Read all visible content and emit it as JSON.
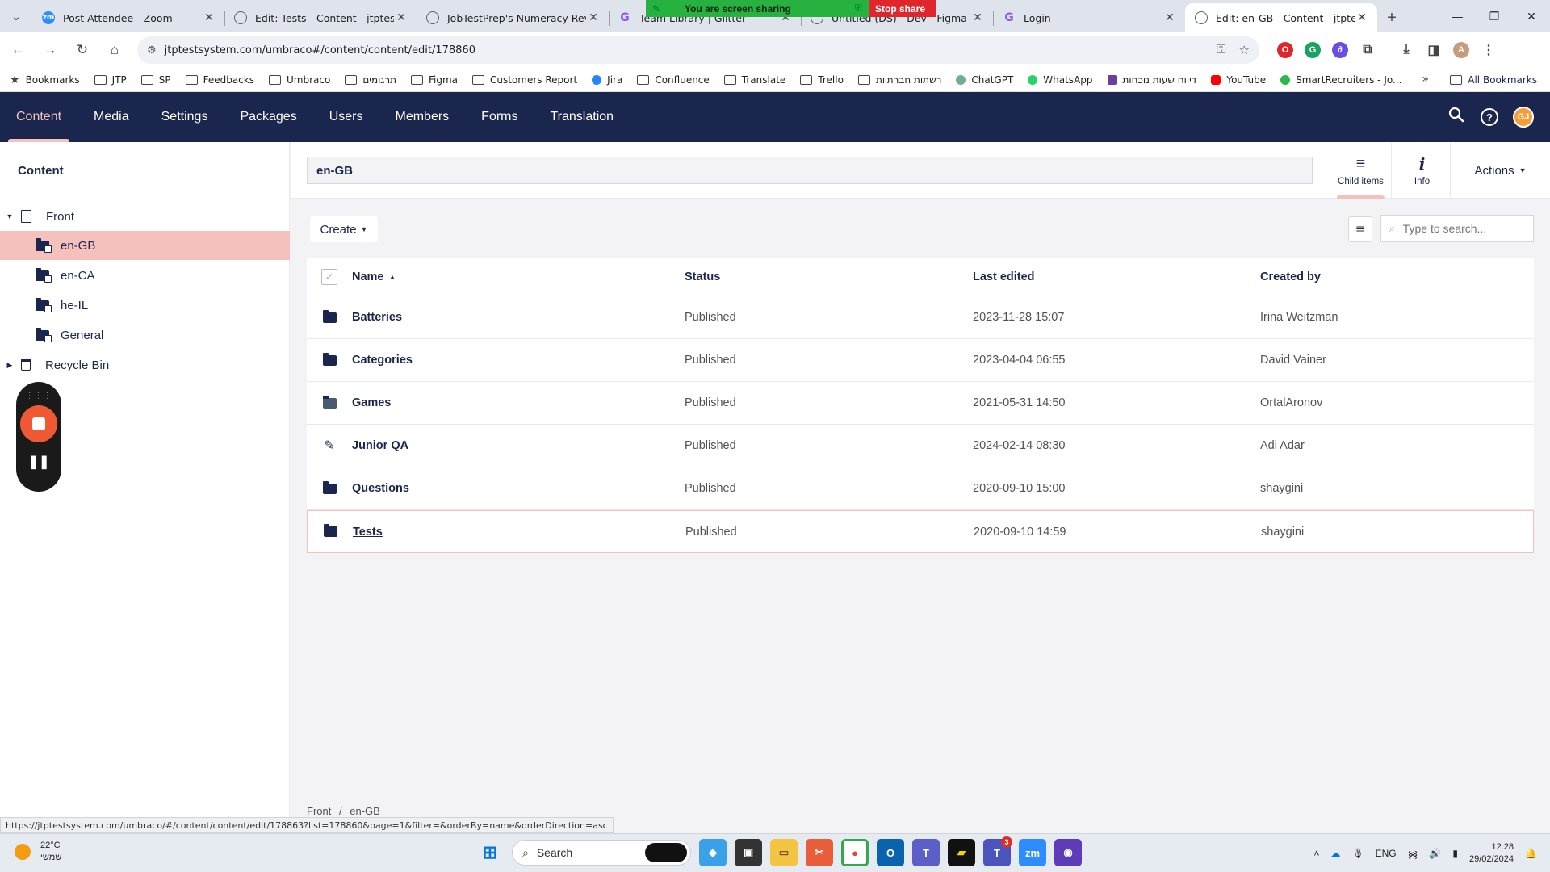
{
  "browser": {
    "tabs": [
      {
        "title": "Post Attendee - Zoom",
        "favicon": "zoom-icon"
      },
      {
        "title": "Edit: Tests - Content - jtptestsy",
        "favicon": "globe-icon"
      },
      {
        "title": "JobTestPrep's Numeracy Review",
        "favicon": "globe-icon"
      },
      {
        "title": "Team Library | Glitter",
        "favicon": "g-icon"
      },
      {
        "title": "Untitled (DS) - Dev - Figma",
        "favicon": "figma-icon"
      },
      {
        "title": "Login",
        "favicon": "g-icon"
      },
      {
        "title": "Edit: en-GB - Content - jtptests",
        "favicon": "globe-icon",
        "active": true
      }
    ],
    "share_banner": {
      "text": "You are screen sharing",
      "stop": "Stop share"
    },
    "url": "jtptestsystem.com/umbraco#/content/content/edit/178860",
    "bookmarks": [
      "Bookmarks",
      "JTP",
      "SP",
      "Feedbacks",
      "Umbraco",
      "תרגומים",
      "Figma",
      "Customers Report",
      "Jira",
      "Confluence",
      "Translate",
      "Trello",
      "רשתות חברתיות",
      "ChatGPT",
      "WhatsApp",
      "דיווח שעות נוכחות",
      "YouTube",
      "SmartRecruiters - Jo..."
    ],
    "all_bookmarks": "All Bookmarks",
    "status_url": "https://jtptestsystem.com/umbraco/#/content/content/edit/178863?list=178860&page=1&filter=&orderBy=name&orderDirection=asc"
  },
  "umbraco": {
    "sections": [
      "Content",
      "Media",
      "Settings",
      "Packages",
      "Users",
      "Members",
      "Forms",
      "Translation"
    ],
    "active_section": "Content",
    "avatar_initials": "GJ",
    "tree": {
      "title": "Content",
      "root": "Front",
      "children": [
        "en-GB",
        "en-CA",
        "he-IL",
        "General"
      ],
      "selected": "en-GB",
      "recycle_bin": "Recycle Bin"
    },
    "editor": {
      "node_name": "en-GB",
      "apps": [
        {
          "label": "Child items",
          "icon": "list-icon"
        },
        {
          "label": "Info",
          "icon": "info-icon"
        }
      ],
      "actions_label": "Actions",
      "create_label": "Create",
      "search_placeholder": "Type to search...",
      "columns": [
        "Name",
        "Status",
        "Last edited",
        "Created by"
      ],
      "rows": [
        {
          "name": "Batteries",
          "status": "Published",
          "edited": "2023-11-28 15:07",
          "created_by": "Irina Weitzman",
          "icon": "folder-icon"
        },
        {
          "name": "Categories",
          "status": "Published",
          "edited": "2023-04-04 06:55",
          "created_by": "David Vainer",
          "icon": "folder-icon"
        },
        {
          "name": "Games",
          "status": "Published",
          "edited": "2021-05-31 14:50",
          "created_by": "OrtalAronov",
          "icon": "folder-icon"
        },
        {
          "name": "Junior QA",
          "status": "Published",
          "edited": "2024-02-14 08:30",
          "created_by": "Adi Adar",
          "icon": "pencil-icon"
        },
        {
          "name": "Questions",
          "status": "Published",
          "edited": "2020-09-10 15:00",
          "created_by": "shaygini",
          "icon": "folder-icon"
        },
        {
          "name": "Tests",
          "status": "Published",
          "edited": "2020-09-10 14:59",
          "created_by": "shaygini",
          "icon": "folder-icon"
        }
      ],
      "breadcrumb": [
        "Front",
        "en-GB"
      ]
    }
  },
  "taskbar": {
    "weather_temp": "22°C",
    "weather_desc": "שמשי",
    "search_label": "Search",
    "language": "ENG",
    "time": "12:28",
    "date": "29/02/2024",
    "teams_badge": "3"
  },
  "colors": {
    "umbraco_nav": "#1b264f",
    "accent": "#f5c1bc",
    "share_green": "#27b23f",
    "stop_red": "#e0262c"
  }
}
